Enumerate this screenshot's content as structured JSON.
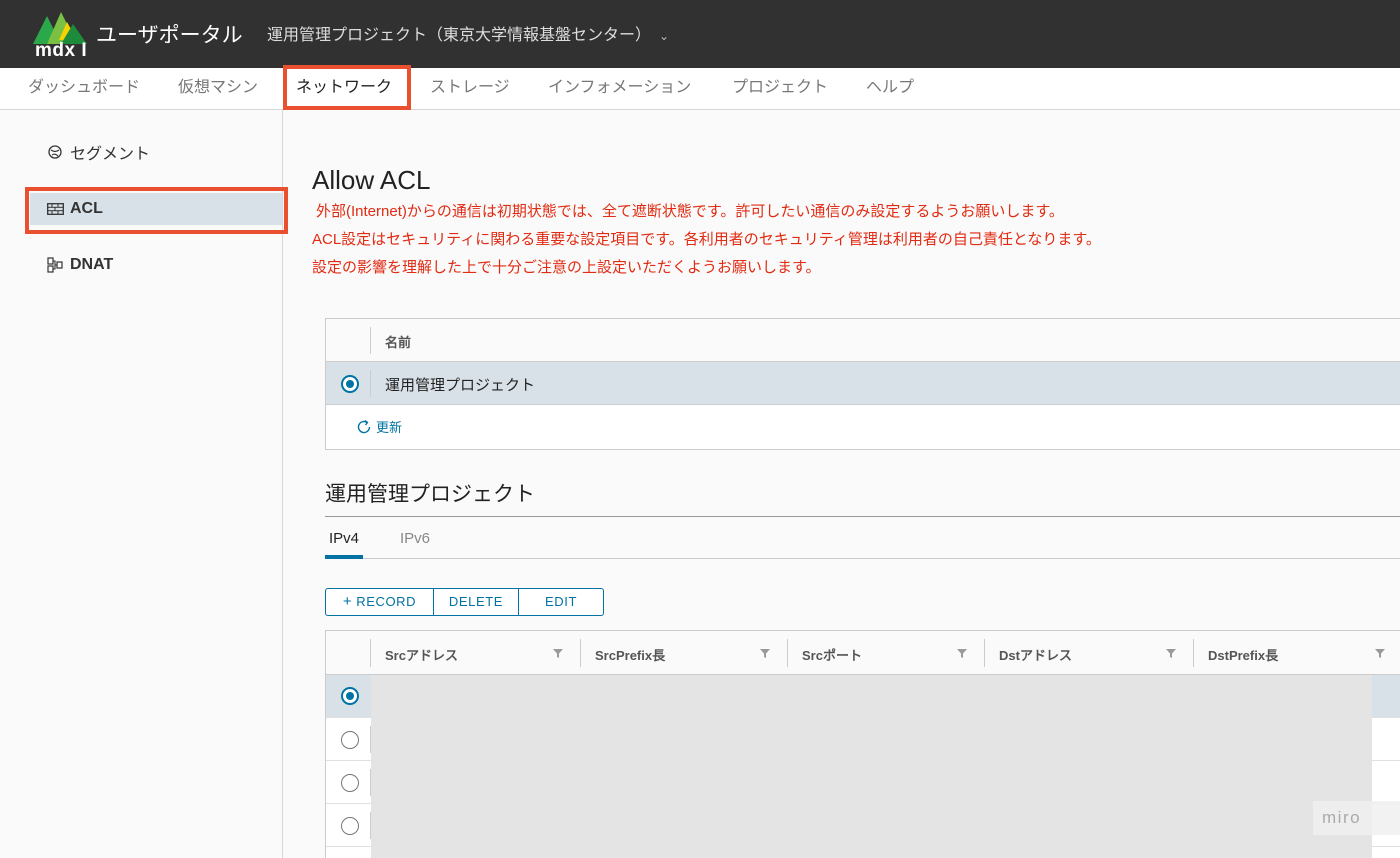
{
  "header": {
    "logo_text": "mdx I",
    "app_title": "ユーザポータル",
    "project_selector": "運用管理プロジェクト（東京大学情報基盤センター）"
  },
  "topnav": {
    "tabs": [
      {
        "label": "ダッシュボード",
        "active": false
      },
      {
        "label": "仮想マシン",
        "active": false
      },
      {
        "label": "ネットワーク",
        "active": true
      },
      {
        "label": "ストレージ",
        "active": false
      },
      {
        "label": "インフォメーション",
        "active": false
      },
      {
        "label": "プロジェクト",
        "active": false
      },
      {
        "label": "ヘルプ",
        "active": false
      }
    ]
  },
  "sidebar": {
    "items": [
      {
        "label": "セグメント",
        "icon": "globe-icon"
      },
      {
        "label": "ACL",
        "icon": "firewall-icon",
        "active": true
      },
      {
        "label": "DNAT",
        "icon": "nat-icon"
      }
    ]
  },
  "main": {
    "title": "Allow ACL",
    "warnings": [
      "外部(Internet)からの通信は初期状態では、全て遮断状態です。許可したい通信のみ設定するようお願いします。",
      "ACL設定はセキュリティに関わる重要な設定項目です。各利用者のセキュリティ管理は利用者の自己責任となります。",
      "設定の影響を理解した上で十分ご注意の上設定いただくようお願いします。"
    ],
    "project_grid": {
      "column": "名前",
      "rows": [
        "運用管理プロジェクト"
      ],
      "refresh_label": "更新"
    },
    "section_title": "運用管理プロジェクト",
    "subtabs": [
      {
        "label": "IPv4",
        "active": true
      },
      {
        "label": "IPv6",
        "active": false
      }
    ],
    "buttons": {
      "record": "RECORD",
      "delete": "DELETE",
      "edit": "EDIT"
    },
    "acl_grid": {
      "columns": [
        "Srcアドレス",
        "SrcPrefix長",
        "Srcポート",
        "Dstアドレス",
        "DstPrefix長"
      ]
    }
  },
  "watermark": "miro",
  "colors": {
    "header_bg": "#313131",
    "highlight": "#e8502f",
    "accent": "#0072a3",
    "warning": "#e12b12",
    "selected_row": "#d9e1e8"
  }
}
